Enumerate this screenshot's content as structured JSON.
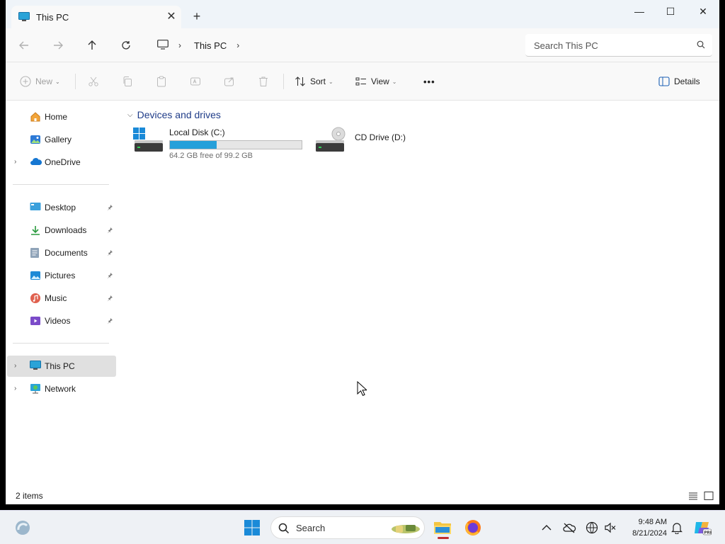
{
  "window": {
    "tab_title": "This PC",
    "close_tab_glyph": "✕",
    "new_tab_glyph": "+",
    "minimize_glyph": "—",
    "maximize_glyph": "☐",
    "close_glyph": "✕"
  },
  "address": {
    "crumbs": [
      "This PC"
    ],
    "search_placeholder": "Search This PC"
  },
  "toolbar": {
    "new_label": "New",
    "sort_label": "Sort",
    "view_label": "View",
    "more_label": "•••",
    "details_label": "Details"
  },
  "sidebar": {
    "items": [
      {
        "label": "Home",
        "icon": "home-icon"
      },
      {
        "label": "Gallery",
        "icon": "gallery-icon"
      },
      {
        "label": "OneDrive",
        "icon": "onedrive-icon"
      },
      {
        "label": "Desktop",
        "icon": "desktop-icon",
        "pinned": true
      },
      {
        "label": "Downloads",
        "icon": "downloads-icon",
        "pinned": true
      },
      {
        "label": "Documents",
        "icon": "documents-icon",
        "pinned": true
      },
      {
        "label": "Pictures",
        "icon": "pictures-icon",
        "pinned": true
      },
      {
        "label": "Music",
        "icon": "music-icon",
        "pinned": true
      },
      {
        "label": "Videos",
        "icon": "videos-icon",
        "pinned": true
      },
      {
        "label": "This PC",
        "icon": "this-pc-icon",
        "selected": true
      },
      {
        "label": "Network",
        "icon": "network-icon"
      }
    ]
  },
  "content": {
    "group_title": "Devices and drives",
    "drives": [
      {
        "name": "Local Disk (C:)",
        "free_text": "64.2 GB free of 99.2 GB",
        "used_fraction": 0.353
      },
      {
        "name": "CD Drive (D:)"
      }
    ]
  },
  "status": {
    "item_count": "2 items"
  },
  "taskbar": {
    "search_label": "Search",
    "time": "9:48 AM",
    "date": "8/21/2024"
  },
  "colors": {
    "accent": "#26a0da",
    "group_header": "#1f3c88",
    "selected_bg": "#e0e0e0"
  }
}
